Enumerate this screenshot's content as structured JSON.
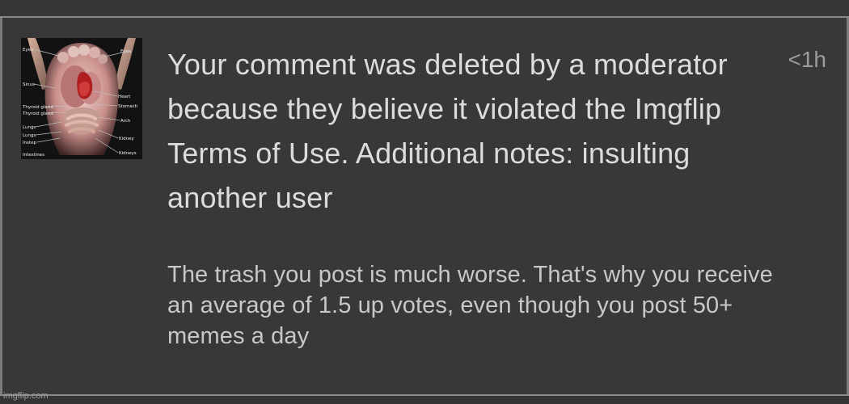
{
  "notification": {
    "message": "Your comment was deleted by a moderator because they believe it violated the Imgflip Terms of Use. Additional notes: insulting another user",
    "comment_preview": "The trash you post is much worse. That's why you receive an average of 1.5 up votes, even though you post 50+ memes a day",
    "timestamp": "<1h",
    "avatar_labels": {
      "left": [
        "Eyes",
        "Sinus",
        "Thyroid gland",
        "Thyroid gland",
        "Lungs",
        "Lungs",
        "Instep",
        "Intestines"
      ],
      "right": [
        "Eyes",
        "Heart",
        "Stomach",
        "Arch",
        "Kidney",
        "Kidneys"
      ]
    }
  },
  "watermark": "imgflip.com",
  "colors": {
    "background": "#3a3a3a",
    "card": "#383838",
    "border": "#8a8a8a",
    "message_text": "#dcdcdc",
    "comment_text": "#c8c8c8",
    "muted_text": "#9c9c9c"
  }
}
